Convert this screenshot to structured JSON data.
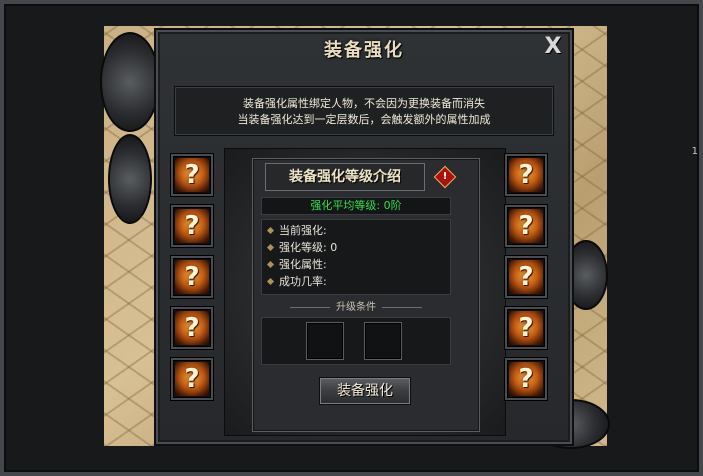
{
  "window": {
    "title": "装备强化",
    "close_label": "X"
  },
  "notice": {
    "line1": "装备强化属性绑定人物，不会因为更换装备而消失",
    "line2": "当装备强化达到一定层数后，会触发额外的属性加成"
  },
  "info_panel": {
    "title": "装备强化等级介绍",
    "warn_symbol": "!",
    "avg_level": "强化平均等级:  0阶",
    "stats": [
      {
        "label": "当前强化:"
      },
      {
        "label": "强化等级: 0"
      },
      {
        "label": "强化属性:"
      },
      {
        "label": "成功几率:"
      }
    ],
    "condition_label": "升级条件"
  },
  "enhance_button_label": "装备强化",
  "unknown_slot_symbol": "?",
  "edge_text": "1",
  "colors": {
    "avg_level_text": "#33e04a",
    "question_icon": "#c25b12",
    "panel_bg": "#2f3235"
  }
}
